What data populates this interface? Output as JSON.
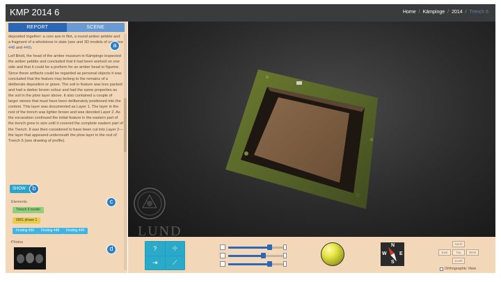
{
  "header": {
    "title": "KMP 2014 6",
    "breadcrumb": [
      "Home",
      "Kämpinge",
      "2014",
      "Trench 6"
    ]
  },
  "left_panel": {
    "tabs": [
      "REPORT",
      "SCENE"
    ],
    "report": {
      "paragraph1_text": "deposited together: a core axe in flint, a round amber pebble and a fragment of a whetstone in slate (see ",
      "paragraph1_tail": "and 3D models of core axe ",
      "paragraph1_link1": "448",
      "paragraph1_and": " and ",
      "paragraph1_link2": "449",
      "paragraph1_end": ").",
      "paragraph2": "Leif Bristl, the head of the amber museum in Kämpinge inspected the amber pebble and concluded that it had been worked on one side and that it could be a preform for an amber bead or figurine. Since these artifacts could be regarded as personal objects it was concluded that the feature may belong to the remains of a deliberate deposition or grave. The soil in feature was less packed and had a darker brown colour and had the same properties as the soil in the plow layer above. It also contained a couple of larger stones that must have been deliberately positioned into the context. This layer was documented as Layer 1. The layer in the rest of the trench was lighter brown and was denoted Layer 2. As the excavation continued the initial feature in the eastern part of the trench grew in size until it covered the complete eastern part of the Trench. It was then considered to have been cut into Layer 2—the layer that appeared underneath the plow layer in the rest of Trench 6 (see drawing of profile)."
    },
    "show_button": "SHOW",
    "annotations": [
      "a",
      "b",
      "c",
      "d"
    ],
    "elements_label": "Elements",
    "elements": {
      "green": "Trench 6 model",
      "yellow": "0001 phase 1",
      "blue": [
        "Finding 450",
        "Finding 448",
        "Finding 449"
      ]
    },
    "photos_label": "Photos"
  },
  "viewport": {
    "watermark": "LUND"
  },
  "toolbar": {
    "tools": [
      "?",
      "⊹",
      "⇥",
      "⟋"
    ],
    "slider_levels": [
      0.7,
      0.6,
      0.7
    ],
    "compass_letters": [
      "N",
      "S",
      "E",
      "W"
    ],
    "nav_buttons": [
      "North",
      "East",
      "Top",
      "West",
      "South"
    ],
    "ortho_label": "Orthographic View"
  },
  "colors": {
    "header_bg": "#3a3b3d",
    "panel_bg": "#f2d7b8",
    "tab_active": "#2b67b5",
    "accent": "#2da4cc",
    "chip_green": "#8fd07a",
    "chip_yellow": "#e8cd4a",
    "chip_blue": "#3fb4e6"
  }
}
